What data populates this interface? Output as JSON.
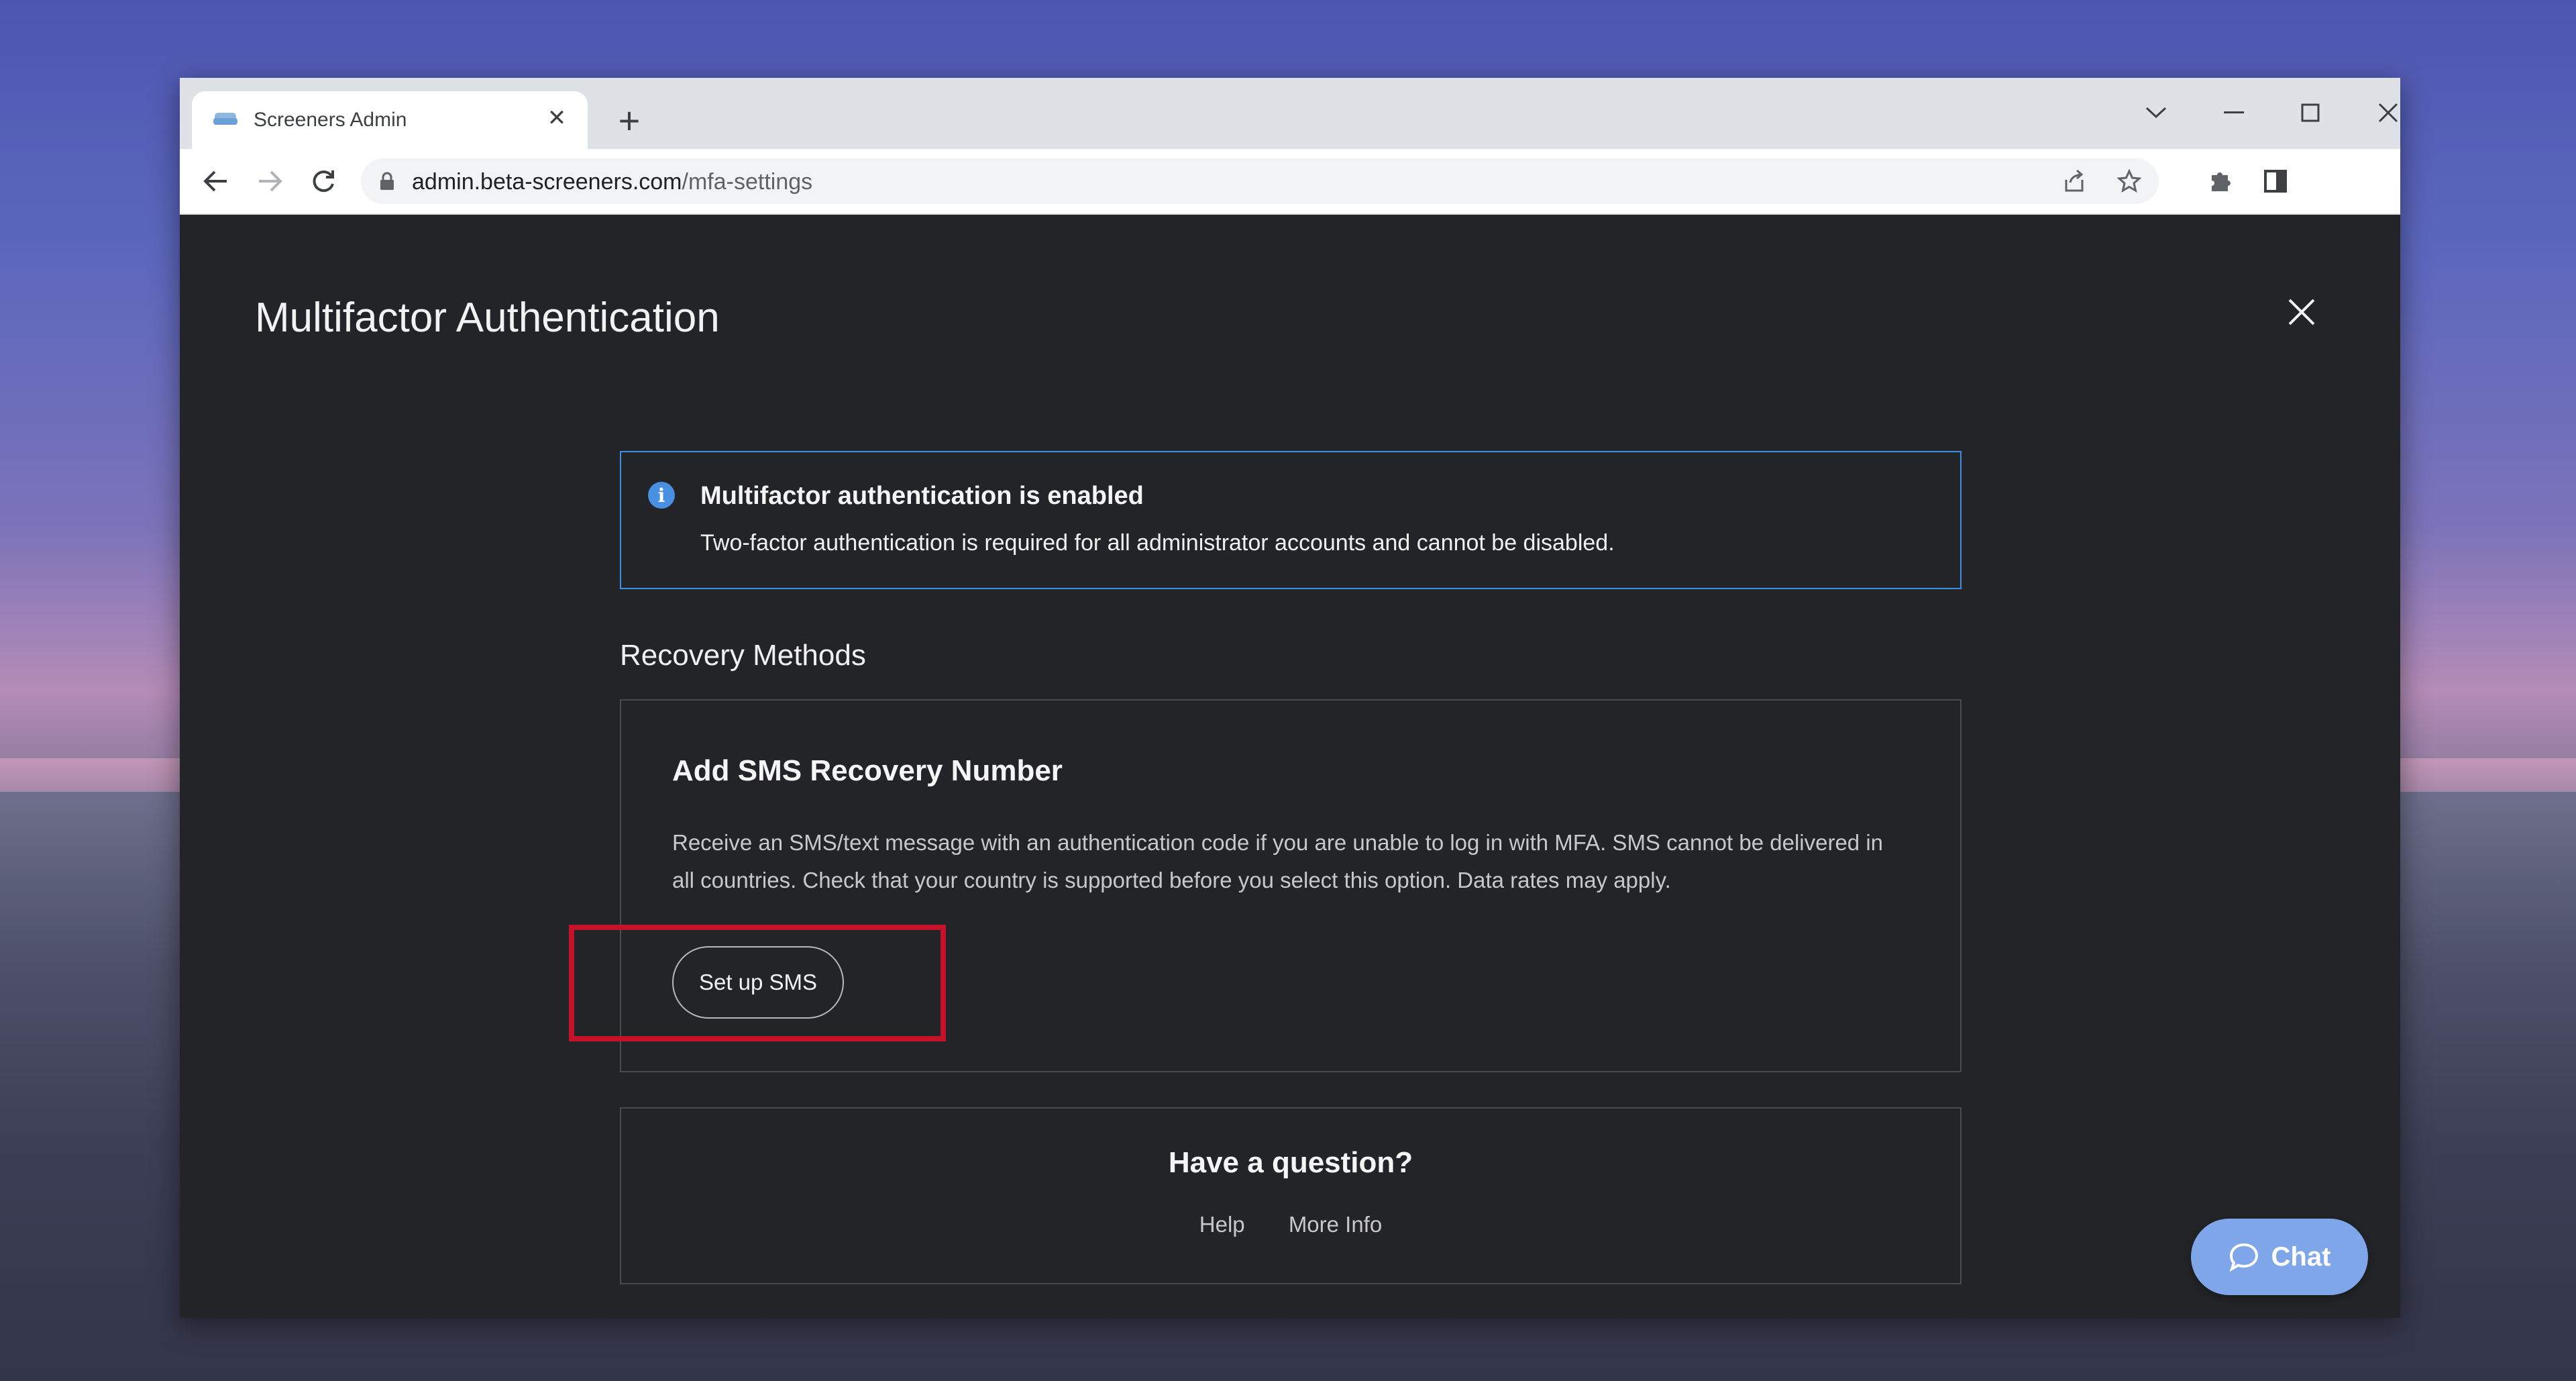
{
  "browser": {
    "tab_title": "Screeners Admin",
    "url_host": "admin.beta-screeners.com",
    "url_path": "/mfa-settings"
  },
  "page": {
    "title": "Multifactor Authentication"
  },
  "info": {
    "title": "Multifactor authentication is enabled",
    "text": "Two-factor authentication is required for all administrator accounts and cannot be disabled."
  },
  "recovery": {
    "heading": "Recovery Methods",
    "card_title": "Add SMS Recovery Number",
    "description": "Receive an SMS/text message with an authentication code if you are unable to log in with MFA. SMS cannot be delivered in all countries. Check that your country is supported before you select this option. Data rates may apply.",
    "button_label": "Set up SMS"
  },
  "help": {
    "title": "Have a question?",
    "help_link": "Help",
    "more_info_link": "More Info"
  },
  "chat": {
    "label": "Chat"
  },
  "colors": {
    "accent_blue": "#3e8de4",
    "highlight_red": "#c5142a",
    "chat_button": "#7ea6e8",
    "page_background": "#232428"
  }
}
